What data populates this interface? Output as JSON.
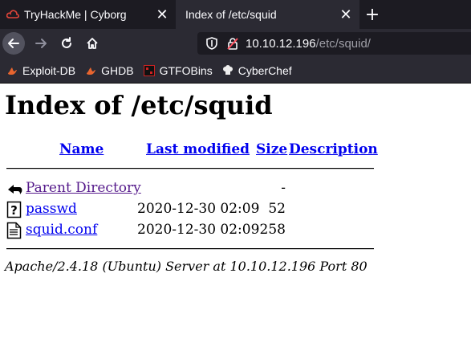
{
  "tabs": [
    {
      "title": "TryHackMe | Cyborg",
      "active": false,
      "favicon": "thm-logo-icon"
    },
    {
      "title": "Index of /etc/squid",
      "active": true
    }
  ],
  "nav": {
    "url_host": "10.10.12.196",
    "url_path": "/etc/squid/"
  },
  "bookmarks": [
    {
      "label": "Exploit-DB",
      "icon": "exploitdb-icon"
    },
    {
      "label": "GHDB",
      "icon": "ghdb-icon"
    },
    {
      "label": "GTFOBins",
      "icon": "gtfobins-icon"
    },
    {
      "label": "CyberChef",
      "icon": "cyberchef-icon"
    }
  ],
  "page": {
    "title": "Index of /etc/squid",
    "columns": {
      "name": "Name",
      "last_modified": "Last modified",
      "size": "Size",
      "description": "Description"
    },
    "rows": [
      {
        "name": "Parent Directory",
        "date": "",
        "size": "-",
        "icon": "back-icon"
      },
      {
        "name": "passwd",
        "date": "2020-12-30 02:09",
        "size": "52",
        "icon": "unknown-file-icon"
      },
      {
        "name": "squid.conf",
        "date": "2020-12-30 02:09",
        "size": "258",
        "icon": "text-file-icon"
      }
    ],
    "footer": "Apache/2.4.18 (Ubuntu) Server at 10.10.12.196 Port 80"
  },
  "colors": {
    "link": "#0000ee",
    "visited": "#551a8b",
    "chrome_dark": "#1c1b22",
    "chrome": "#2b2a33"
  }
}
